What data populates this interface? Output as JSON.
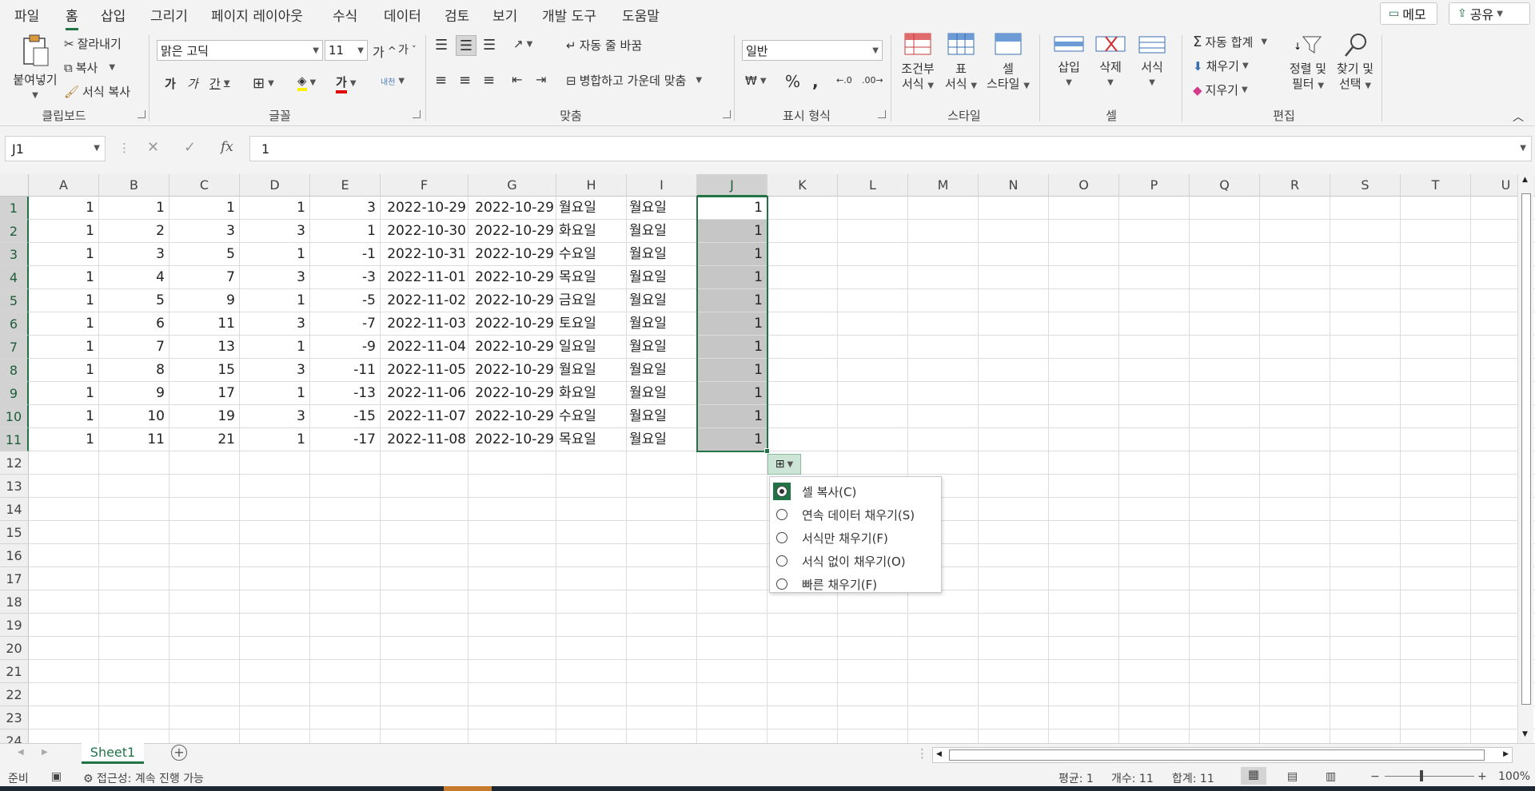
{
  "menu": {
    "items": [
      "파일",
      "홈",
      "삽입",
      "그리기",
      "페이지 레이아웃",
      "수식",
      "데이터",
      "검토",
      "보기",
      "개발 도구",
      "도움말"
    ],
    "memo_label": "메모",
    "share_label": "공유"
  },
  "ribbon": {
    "clipboard": {
      "paste": "붙여넣기",
      "cut": "잘라내기",
      "copy": "복사",
      "format_painter": "서식 복사",
      "label": "클립보드"
    },
    "font": {
      "font_name": "맑은 고딕",
      "font_size": "11",
      "bold": "가",
      "italic": "가",
      "underline": "간",
      "grow": "가",
      "shrink": "가",
      "font_color_glyph": "가",
      "phonetic": "내천",
      "label": "글꼴"
    },
    "alignment": {
      "wrap_text": "자동 줄 바꿈",
      "merge_center": "병합하고 가운데 맞춤",
      "label": "맞춤"
    },
    "number": {
      "format": "일반",
      "label": "표시 형식"
    },
    "styles": {
      "conditional": [
        "조건부",
        "서식"
      ],
      "table": [
        "표",
        "서식"
      ],
      "cell": [
        "셀",
        "스타일"
      ],
      "label": "스타일"
    },
    "cells": {
      "insert": "삽입",
      "delete": "삭제",
      "format": "서식",
      "label": "셀"
    },
    "editing": {
      "autosum": "자동 합계",
      "fill": "채우기",
      "clear": "지우기",
      "sort_filter": [
        "정렬 및",
        "필터"
      ],
      "find_select": [
        "찾기 및",
        "선택"
      ],
      "label": "편집"
    }
  },
  "formula_bar": {
    "name_box": "J1",
    "fx": "fx",
    "value": "1"
  },
  "columns": [
    "A",
    "B",
    "C",
    "D",
    "E",
    "F",
    "G",
    "H",
    "I",
    "J",
    "K",
    "L",
    "M",
    "N",
    "O",
    "P",
    "Q",
    "R",
    "S",
    "T",
    "U"
  ],
  "row_numbers": [
    "1",
    "2",
    "3",
    "4",
    "5",
    "6",
    "7",
    "8",
    "9",
    "10",
    "11",
    "12",
    "13",
    "14",
    "15",
    "16",
    "17",
    "18",
    "19",
    "20",
    "21",
    "22",
    "23",
    "24"
  ],
  "rows": [
    [
      "1",
      "1",
      "1",
      "1",
      "3",
      "2022-10-29",
      "2022-10-29",
      "월요일",
      "월요일",
      "1"
    ],
    [
      "1",
      "2",
      "3",
      "3",
      "1",
      "2022-10-30",
      "2022-10-29",
      "화요일",
      "월요일",
      "1"
    ],
    [
      "1",
      "3",
      "5",
      "1",
      "-1",
      "2022-10-31",
      "2022-10-29",
      "수요일",
      "월요일",
      "1"
    ],
    [
      "1",
      "4",
      "7",
      "3",
      "-3",
      "2022-11-01",
      "2022-10-29",
      "목요일",
      "월요일",
      "1"
    ],
    [
      "1",
      "5",
      "9",
      "1",
      "-5",
      "2022-11-02",
      "2022-10-29",
      "금요일",
      "월요일",
      "1"
    ],
    [
      "1",
      "6",
      "11",
      "3",
      "-7",
      "2022-11-03",
      "2022-10-29",
      "토요일",
      "월요일",
      "1"
    ],
    [
      "1",
      "7",
      "13",
      "1",
      "-9",
      "2022-11-04",
      "2022-10-29",
      "일요일",
      "월요일",
      "1"
    ],
    [
      "1",
      "8",
      "15",
      "3",
      "-11",
      "2022-11-05",
      "2022-10-29",
      "월요일",
      "월요일",
      "1"
    ],
    [
      "1",
      "9",
      "17",
      "1",
      "-13",
      "2022-11-06",
      "2022-10-29",
      "화요일",
      "월요일",
      "1"
    ],
    [
      "1",
      "10",
      "19",
      "3",
      "-15",
      "2022-11-07",
      "2022-10-29",
      "수요일",
      "월요일",
      "1"
    ],
    [
      "1",
      "11",
      "21",
      "1",
      "-17",
      "2022-11-08",
      "2022-10-29",
      "목요일",
      "월요일",
      "1"
    ]
  ],
  "autofill_menu": {
    "items": [
      {
        "label": "셀 복사(C)",
        "selected": true
      },
      {
        "label": "연속 데이터 채우기(S)",
        "selected": false
      },
      {
        "label": "서식만 채우기(F)",
        "selected": false
      },
      {
        "label": "서식 없이 채우기(O)",
        "selected": false
      },
      {
        "label": "빠른 채우기(F)",
        "selected": false
      }
    ]
  },
  "sheet_tab": "Sheet1",
  "status": {
    "ready": "준비",
    "accessibility": "접근성: 계속 진행 가능",
    "average": "평균: 1",
    "count": "개수: 11",
    "sum": "합계: 11",
    "zoom": "100%"
  },
  "colors": {
    "accent": "#217346",
    "selection_fill": "#c6c6c6"
  }
}
